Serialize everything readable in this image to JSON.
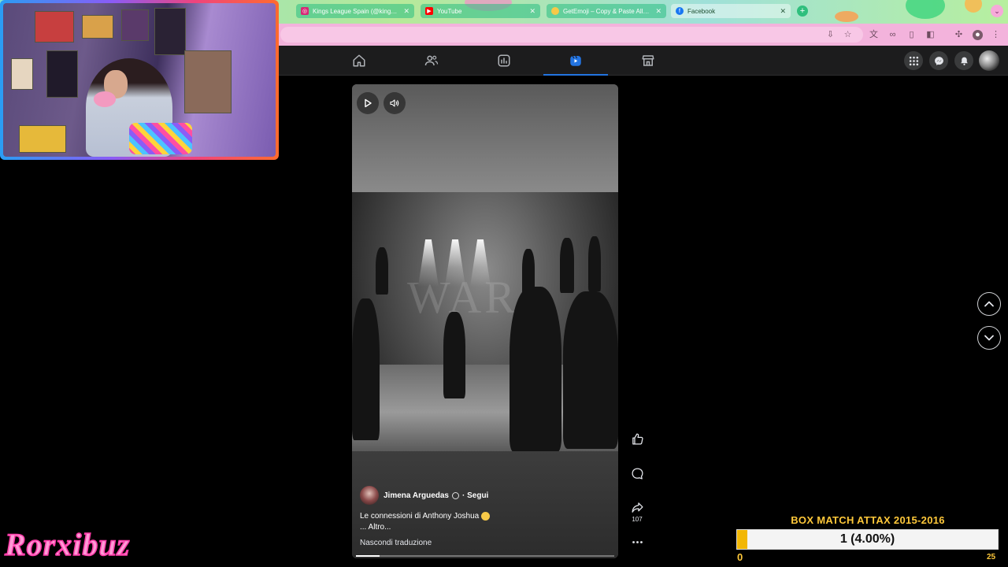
{
  "browser": {
    "tabs": [
      {
        "title": "Kings League Spain (@kings…",
        "icon": "instagram-icon",
        "color": "#d62976"
      },
      {
        "title": "YouTube",
        "icon": "youtube-icon",
        "color": "#ff0000"
      },
      {
        "title": "GetEmoji – Copy & Paste All E…",
        "icon": "emoji-icon",
        "color": "#f7c948"
      },
      {
        "title": "Facebook",
        "icon": "facebook-icon",
        "color": "#1877f2",
        "active": true
      }
    ],
    "new_tab": "+"
  },
  "facebook": {
    "nav": [
      {
        "name": "home",
        "active": false
      },
      {
        "name": "friends",
        "active": false
      },
      {
        "name": "feeds",
        "active": false
      },
      {
        "name": "reels",
        "active": true
      },
      {
        "name": "marketplace",
        "active": false
      }
    ],
    "accent": "#2374e1"
  },
  "reel": {
    "author": "Jimena Arguedas",
    "follow_label": "· Segui",
    "caption": "Le connessioni di Anthony Joshua",
    "more_label": "... Altro...",
    "hide_translation": "Nascondi traduzione",
    "scene_text": "WAR",
    "share_count": "107",
    "progress": 0.09
  },
  "stream": {
    "name": "Rorxibuz",
    "goal_title": "BOX MATCH ATTAX 2015-2016",
    "goal_value": "1 (4.00%)",
    "goal_min": "0",
    "goal_max": "25",
    "goal_fraction": 0.04,
    "goal_color": "#f2b705"
  }
}
